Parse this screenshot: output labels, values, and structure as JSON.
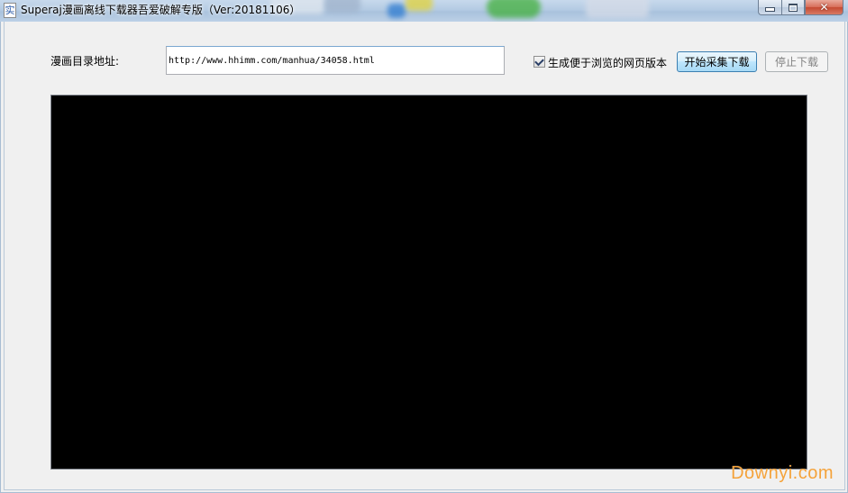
{
  "window": {
    "title": "Superaj漫画离线下载器吾爱破解专版（Ver:20181106）",
    "icon": "comic-app-icon",
    "icon_glyph": "实",
    "close_glyph": "✕"
  },
  "form": {
    "url_label": "漫画目录地址:",
    "url_value": "http://www.hhimm.com/manhua/34058.html",
    "browse_checkbox_label": "生成便于浏览的网页版本",
    "browse_checked": true,
    "start_button_label": "开始采集下载",
    "stop_button_label": "停止下载",
    "stop_button_enabled": false
  },
  "log": {
    "content": ""
  },
  "watermark": {
    "text": "Downyi.com"
  },
  "colors": {
    "log_background": "#000000",
    "watermark": "#f4a23a",
    "button_border_active": "#3c7fb1"
  }
}
